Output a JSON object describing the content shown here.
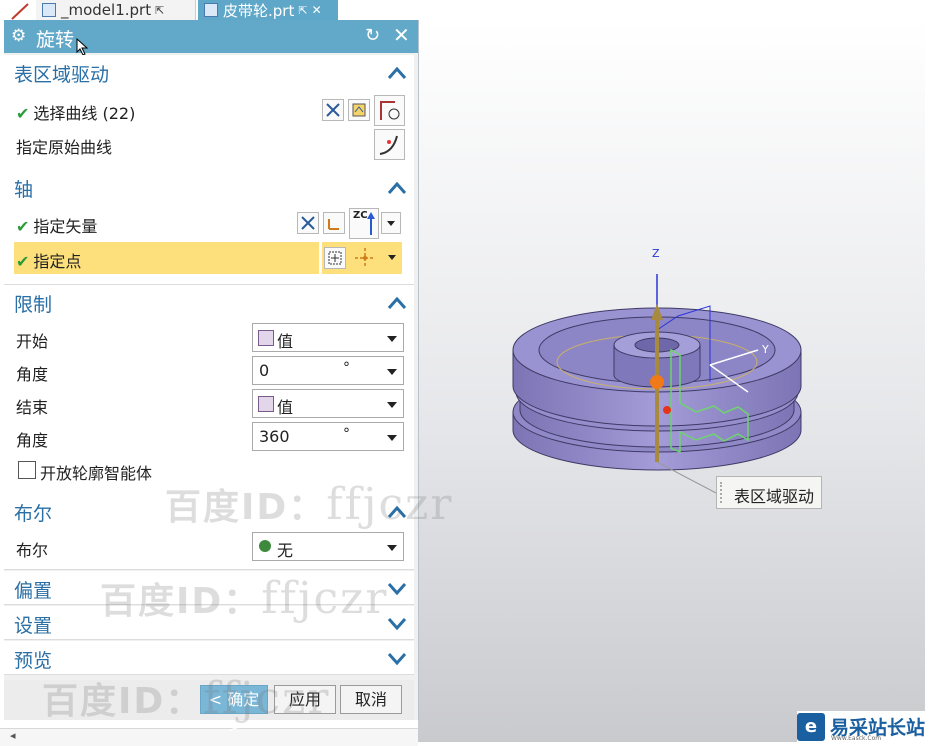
{
  "tabs": [
    {
      "label": "_model1.prt"
    },
    {
      "label": "皮带轮.prt"
    }
  ],
  "dialog": {
    "title": "旋转",
    "surface_region": {
      "header": "表区域驱动",
      "select_curve": "选择曲线 (22)",
      "specify_original_curve": "指定原始曲线"
    },
    "axis": {
      "header": "轴",
      "specify_vector": "指定矢量",
      "vector_type": "ZC",
      "specify_point": "指定点"
    },
    "limits": {
      "header": "限制",
      "start_label": "开始",
      "start_value": "值",
      "start_angle_label": "角度",
      "start_angle_value": "0",
      "end_label": "结束",
      "end_value": "值",
      "end_angle_label": "角度",
      "end_angle_value": "360",
      "angle_unit": "°",
      "open_profile_label": "开放轮廓智能体",
      "open_profile_checked": false
    },
    "boolean": {
      "header": "布尔",
      "label": "布尔",
      "value": "无"
    },
    "offset": {
      "header": "偏置"
    },
    "settings": {
      "header": "设置"
    },
    "preview": {
      "header": "预览"
    },
    "buttons": {
      "ok": "< 确定 >",
      "apply": "应用",
      "cancel": "取消"
    }
  },
  "viewport": {
    "axis_z": "Z",
    "axis_y": "Y",
    "tooltip": "表区域驱动",
    "body_color": "#8f87c6"
  },
  "watermark": {
    "prefix": "百度ID：",
    "handle": "ffjczr"
  },
  "logo": {
    "name": "易采站长站",
    "subtitle": "Www.Easck.Com"
  },
  "colors": {
    "title_bar": "#62a8c8",
    "section_header": "#2a6fa6",
    "highlight_row": "#fde07b",
    "check": "#2a9d3a"
  }
}
